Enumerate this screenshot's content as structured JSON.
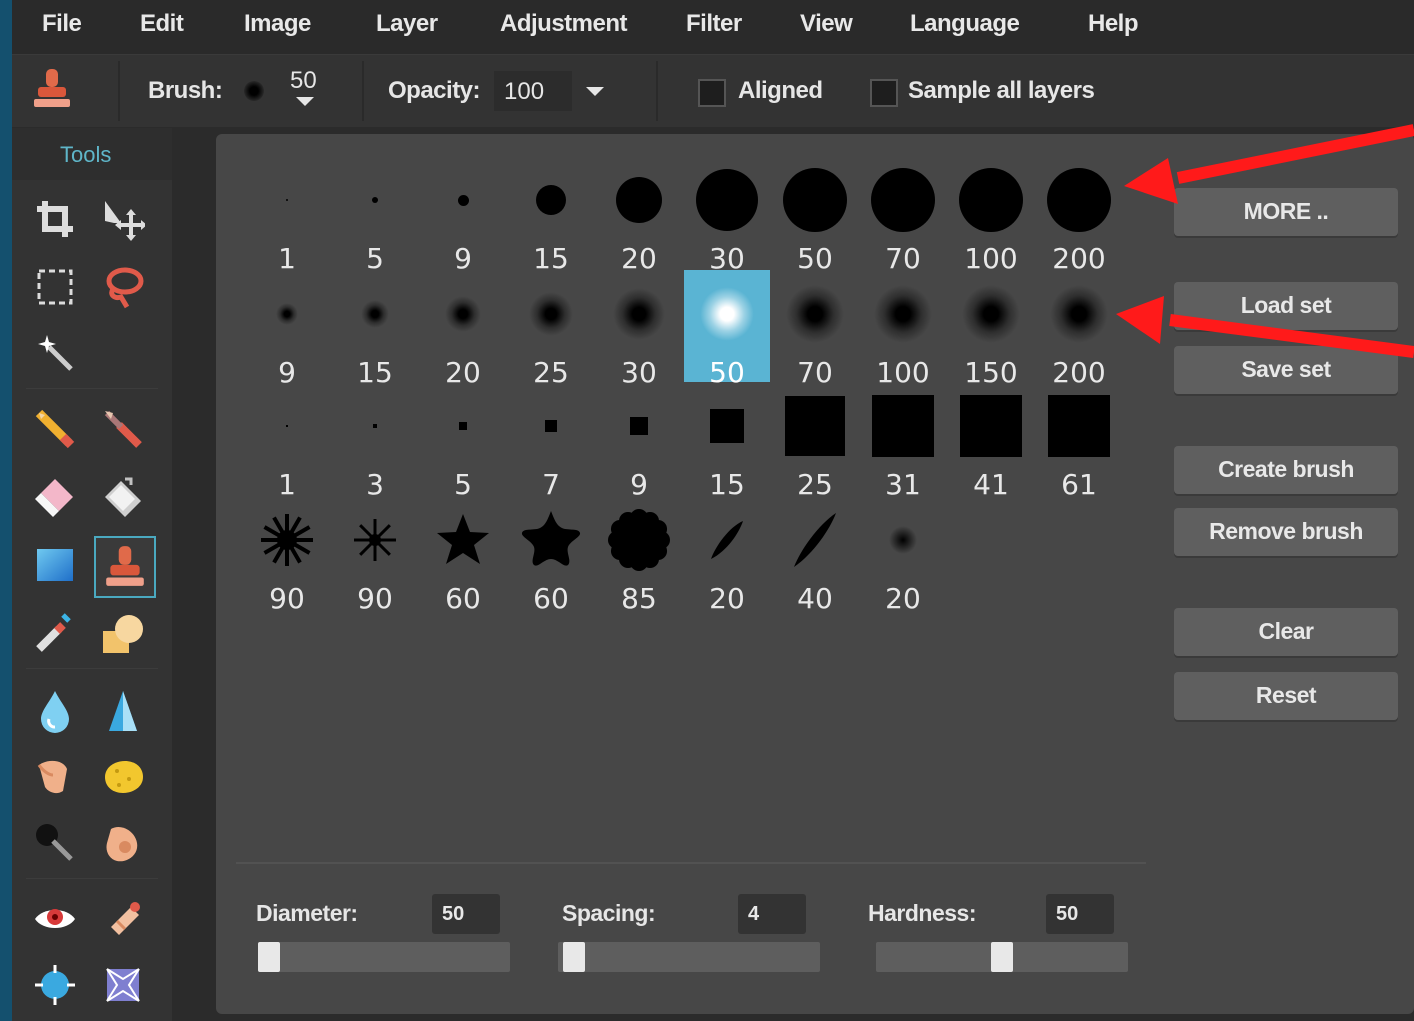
{
  "menu": [
    "File",
    "Edit",
    "Image",
    "Layer",
    "Adjustment",
    "Filter",
    "View",
    "Language",
    "Help"
  ],
  "toolbar": {
    "brush_label": "Brush:",
    "brush_size": "50",
    "opacity_label": "Opacity:",
    "opacity_value": "100",
    "aligned_label": "Aligned",
    "aligned_checked": false,
    "sample_label": "Sample all layers",
    "sample_checked": false
  },
  "tools": {
    "title": "Tools",
    "items": [
      "crop-icon",
      "move-icon",
      "marquee-icon",
      "lasso-icon",
      "magic-wand-icon",
      "pencil-icon",
      "brush-icon",
      "eraser-icon",
      "bucket-icon",
      "gradient-icon",
      "clone-stamp-icon",
      "color-replace-icon",
      "shape-icon",
      "blur-icon",
      "sharpen-icon",
      "smudge-icon",
      "sponge-icon",
      "dodge-icon",
      "burn-icon",
      "red-eye-icon",
      "spot-heal-icon",
      "bloat-icon",
      "pinch-icon"
    ],
    "active": "clone-stamp-icon"
  },
  "brushes": {
    "row1": {
      "kind": "hard-circle",
      "sizes": [
        "1",
        "5",
        "9",
        "15",
        "20",
        "30",
        "50",
        "70",
        "100",
        "200"
      ]
    },
    "row2": {
      "kind": "soft-circle",
      "sizes": [
        "9",
        "15",
        "20",
        "25",
        "30",
        "50",
        "70",
        "100",
        "150",
        "200"
      ],
      "selected_index": 5
    },
    "row3": {
      "kind": "square",
      "sizes": [
        "1",
        "3",
        "5",
        "7",
        "9",
        "15",
        "25",
        "31",
        "41",
        "61"
      ]
    },
    "row4": {
      "kind": "shape",
      "sizes": [
        "90",
        "90",
        "60",
        "60",
        "85",
        "20",
        "40",
        "20"
      ],
      "shapes": [
        "splat-icon",
        "star-thin-icon",
        "star-icon",
        "starfish-icon",
        "flower-icon",
        "leaf-icon",
        "leaf-long-icon",
        "soft-dot-icon"
      ]
    }
  },
  "buttons": {
    "more": "MORE ..",
    "load": "Load set",
    "save": "Save set",
    "create": "Create brush",
    "remove": "Remove brush",
    "clear": "Clear",
    "reset": "Reset"
  },
  "controls": {
    "diameter_label": "Diameter:",
    "diameter_value": "50",
    "spacing_label": "Spacing:",
    "spacing_value": "4",
    "hardness_label": "Hardness:",
    "hardness_value": "50",
    "diameter_level": 0.0,
    "spacing_level": 0.02,
    "hardness_level": 0.5
  },
  "colors": {
    "accent": "#5ab4d3",
    "annotation_arrow": "#ff1a1a"
  }
}
